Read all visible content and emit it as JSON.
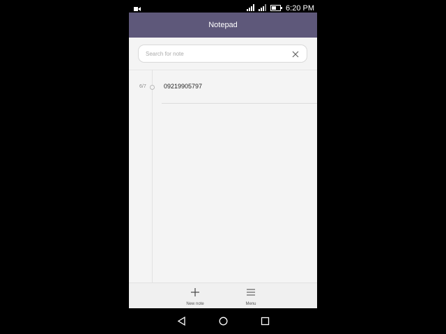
{
  "status_bar": {
    "time": "6:20 PM"
  },
  "app_bar": {
    "title": "Notepad"
  },
  "search": {
    "placeholder": "Search for note",
    "value": ""
  },
  "notes": [
    {
      "date": "6/7",
      "text": "09219905797"
    }
  ],
  "bottom_bar": {
    "new_note_label": "New note",
    "menu_label": "Menu"
  },
  "colors": {
    "app_bar": "#5e587a",
    "content_bg": "#f4f4f4"
  }
}
